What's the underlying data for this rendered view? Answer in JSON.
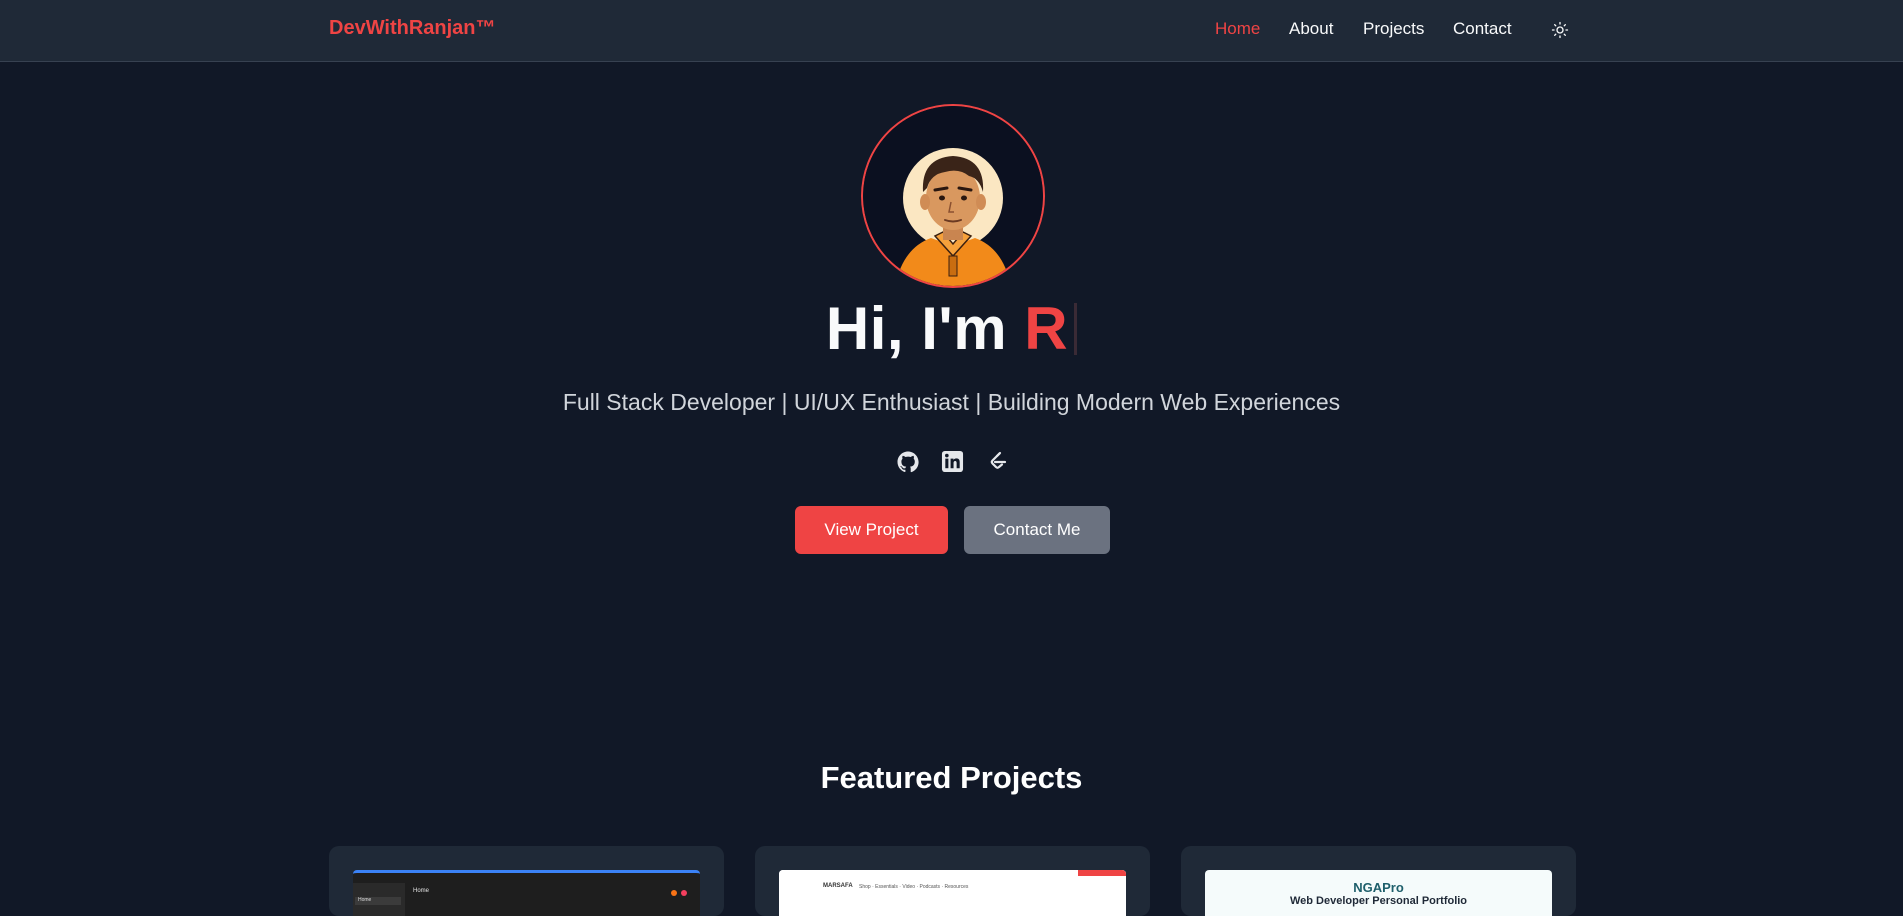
{
  "nav": {
    "brand": "DevWithRanjan™",
    "links": [
      {
        "label": "Home",
        "active": true
      },
      {
        "label": "About",
        "active": false
      },
      {
        "label": "Projects",
        "active": false
      },
      {
        "label": "Contact",
        "active": false
      }
    ],
    "theme_icon": "sun-icon"
  },
  "hero": {
    "greeting": "Hi, I'm ",
    "typed_name": "R",
    "subtitle": "Full Stack Developer | UI/UX Enthusiast | Building Modern Web Experiences",
    "socials": [
      {
        "icon": "github-icon"
      },
      {
        "icon": "linkedin-icon"
      },
      {
        "icon": "leetcode-icon"
      }
    ],
    "primary_button": "View Project",
    "secondary_button": "Contact Me"
  },
  "featured": {
    "title": "Featured Projects",
    "cards": [
      {
        "thumb_label": "Home",
        "thumb_side": "Home"
      },
      {
        "thumb_logo": "MARSAFA",
        "thumb_menu": "Shop ·  Essentials ·  Video ·  Podcasts ·  Resources"
      },
      {
        "thumb_logo": "NGAPro",
        "thumb_sub": "Web Developer Personal Portfolio"
      }
    ]
  },
  "colors": {
    "accent": "#ef4444",
    "background": "#111827",
    "navbar": "#1f2937",
    "secondary_button": "#6b7280"
  }
}
